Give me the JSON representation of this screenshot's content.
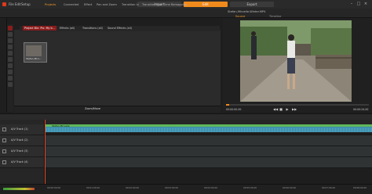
{
  "menu": [
    "File",
    "Edit",
    "Setup"
  ],
  "modes": {
    "import": "Import",
    "edit": "Edit",
    "export": "Export"
  },
  "tabs": [
    "Projects",
    "Connected",
    "Effect",
    "Pan and Zoom",
    "Transition In",
    "Transition Out",
    "Time Remapping"
  ],
  "preview": {
    "title": "Stefan-Mirvelle-Winter.MP4",
    "source_tab": "Source",
    "timeline_tab": "Timeline",
    "tc_left": "00:00:00.00",
    "tc_right": "00:00:24.00"
  },
  "library": {
    "tabs": [
      "Project Bin: Pix: My b...",
      "Effects (all)",
      "Transitions (all)",
      "Sound Effects (all)"
    ],
    "clip_label": "Stefan-Mirv...",
    "zoom_label": "Zoom/Move"
  },
  "timeline": {
    "tracks": [
      "A/V Track (1)",
      "A/V Track (2)",
      "A/V Track (3)",
      "A/V Track (4)"
    ],
    "clip_name": "Stefan-Mirvelle",
    "ruler": [
      "00:00:00.00",
      "00:01:00.00",
      "00:02:00.00",
      "00:03:00.00",
      "00:04:00.00",
      "00:05:00.00",
      "00:06:00.00",
      "00:07:00.00",
      "00:08:00.00"
    ]
  },
  "colors": {
    "accent": "#f08a1c",
    "project_tab": "#8a1c1c",
    "clip": "#3b8aa6",
    "clip_header": "#5fb85a",
    "playhead": "#e34a2a"
  },
  "icons": [
    "minimize-icon",
    "maximize-icon",
    "close-icon",
    "play-icon",
    "stop-icon",
    "rewind-icon",
    "fast-forward-icon",
    "lock-icon"
  ]
}
